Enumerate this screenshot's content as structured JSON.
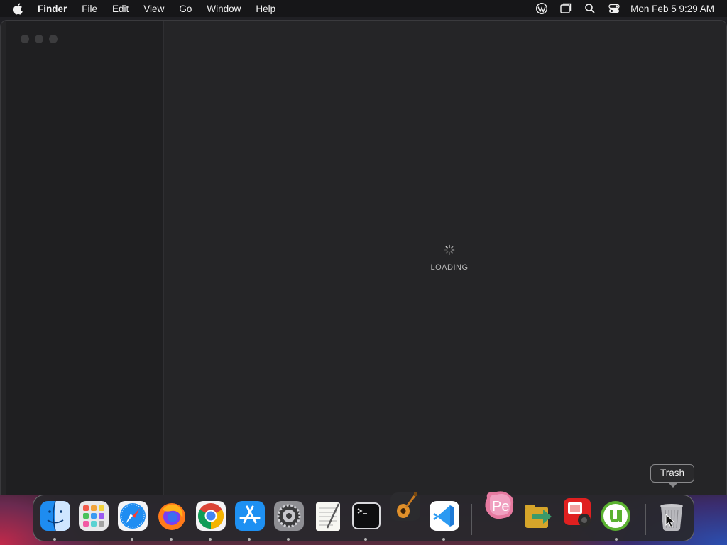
{
  "menubar": {
    "app_name": "Finder",
    "items": [
      "File",
      "Edit",
      "View",
      "Go",
      "Window",
      "Help"
    ],
    "clock": "Mon Feb 5  9:29 AM",
    "status_icons": [
      "wordpress-icon",
      "window-icon",
      "search-icon",
      "control-center-icon"
    ]
  },
  "window": {
    "loading_text": "LOADING"
  },
  "tooltip": {
    "label": "Trash"
  },
  "dock": {
    "items": [
      {
        "name": "finder-icon",
        "running": true
      },
      {
        "name": "launchpad-icon",
        "running": false
      },
      {
        "name": "safari-icon",
        "running": true
      },
      {
        "name": "firefox-icon",
        "running": true
      },
      {
        "name": "chrome-icon",
        "running": true
      },
      {
        "name": "app-store-icon",
        "running": true
      },
      {
        "name": "system-settings-icon",
        "running": true
      },
      {
        "name": "textedit-icon",
        "running": false
      },
      {
        "name": "terminal-icon",
        "running": true
      },
      {
        "name": "garageband-icon",
        "running": false
      },
      {
        "name": "vscode-icon",
        "running": true
      },
      {
        "name": "premiere-elements-icon",
        "running": false
      },
      {
        "name": "file-transfer-icon",
        "running": false
      },
      {
        "name": "photo-booth-icon",
        "running": false
      },
      {
        "name": "utorrent-icon",
        "running": true
      },
      {
        "name": "trash-icon",
        "running": false
      }
    ]
  },
  "colors": {
    "menubar_bg": "#161618",
    "window_bg": "#252527",
    "sidebar_bg": "#1f1f21"
  }
}
